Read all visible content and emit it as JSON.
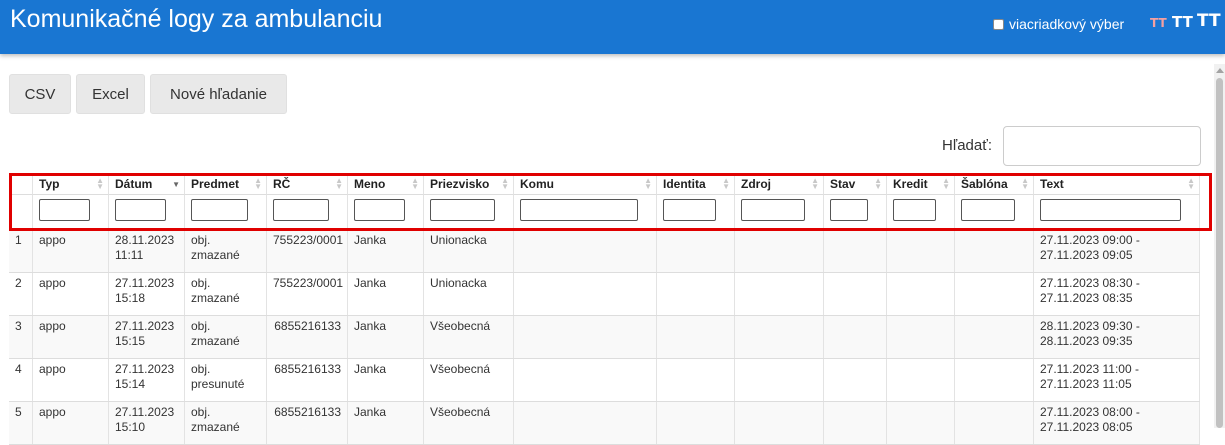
{
  "header": {
    "title": "Komunikačné logy za ambulanciu",
    "multiselect_label": "viacriadkový výber",
    "font_icons": [
      "A-small",
      "A-medium",
      "A-large"
    ]
  },
  "toolbar": {
    "csv": "CSV",
    "excel": "Excel",
    "new_search": "Nové hľadanie"
  },
  "search": {
    "label": "Hľadať:",
    "value": ""
  },
  "table": {
    "columns": [
      "Typ",
      "Dátum",
      "Predmet",
      "RČ",
      "Meno",
      "Priezvisko",
      "Komu",
      "Identita",
      "Zdroj",
      "Stav",
      "Kredit",
      "Šablóna",
      "Text"
    ],
    "sorted_column": "Dátum",
    "rows": [
      {
        "num": "1",
        "typ": "appo",
        "datum": "28.11.2023 11:11",
        "predmet": "obj. zmazané",
        "rc": "755223/0001",
        "meno": "Janka",
        "priezvisko": "Unionacka",
        "text": "27.11.2023 09:00 - 27.11.2023 09:05"
      },
      {
        "num": "2",
        "typ": "appo",
        "datum": "27.11.2023 15:18",
        "predmet": "obj. zmazané",
        "rc": "755223/0001",
        "meno": "Janka",
        "priezvisko": "Unionacka",
        "text": "27.11.2023 08:30 - 27.11.2023 08:35"
      },
      {
        "num": "3",
        "typ": "appo",
        "datum": "27.11.2023 15:15",
        "predmet": "obj. zmazané",
        "rc": "6855216133",
        "meno": "Janka",
        "priezvisko": "Všeobecná",
        "text": "28.11.2023 09:30 - 28.11.2023 09:35"
      },
      {
        "num": "4",
        "typ": "appo",
        "datum": "27.11.2023 15:14",
        "predmet": "obj. presunuté",
        "rc": "6855216133",
        "meno": "Janka",
        "priezvisko": "Všeobecná",
        "text": "27.11.2023 11:00 - 27.11.2023 11:05"
      },
      {
        "num": "5",
        "typ": "appo",
        "datum": "27.11.2023 15:10",
        "predmet": "obj. zmazané",
        "rc": "6855216133",
        "meno": "Janka",
        "priezvisko": "Všeobecná",
        "text": "27.11.2023 08:00 - 27.11.2023 08:05"
      }
    ]
  },
  "colors": {
    "header": "#1976d2",
    "highlight_border": "#e00000"
  }
}
